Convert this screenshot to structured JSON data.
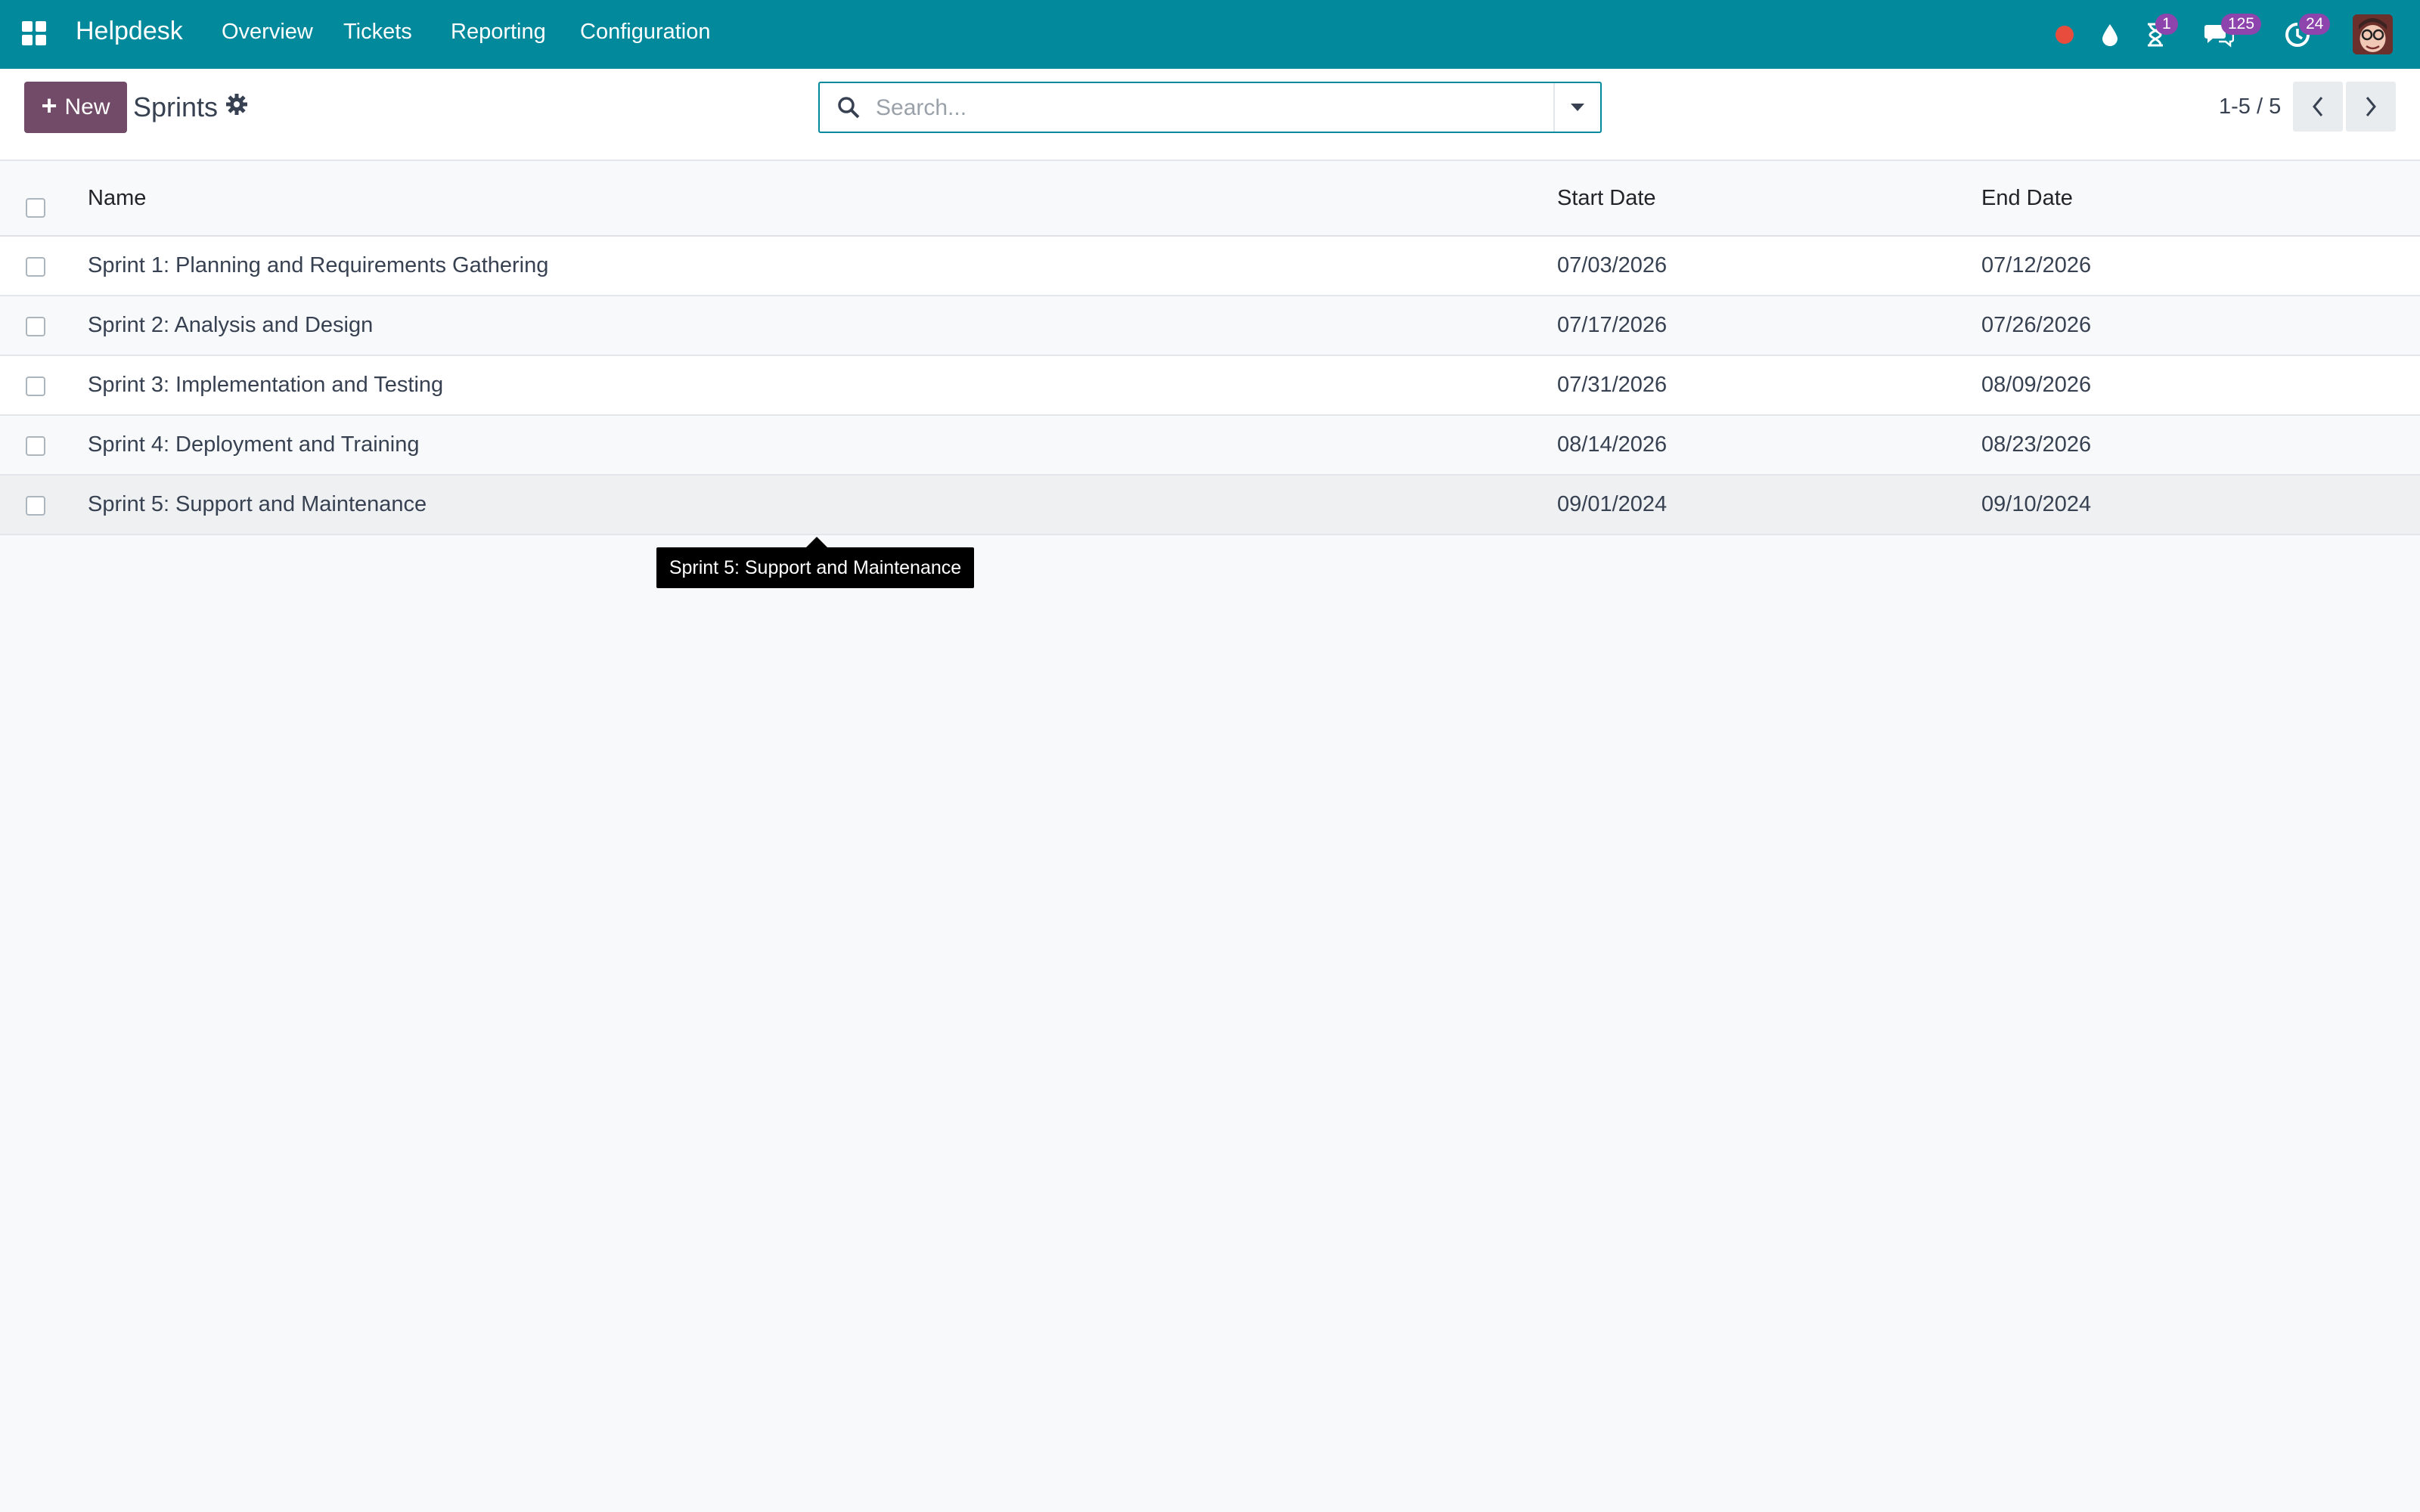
{
  "navbar": {
    "apps_icon": "apps-grid-icon",
    "brand": "Helpdesk",
    "menu": [
      "Overview",
      "Tickets",
      "Reporting",
      "Configuration"
    ],
    "systray": {
      "record_icon": "record-dot-icon",
      "drop_icon": "drop-icon",
      "activity_badge": "1",
      "messages_badge": "125",
      "clock_badge": "24"
    },
    "colors": {
      "bar": "#02899c",
      "badge": "#8e44ad",
      "record": "#e74c3c"
    }
  },
  "control": {
    "new_label": "New",
    "breadcrumb": "Sprints",
    "search_placeholder": "Search...",
    "pager": "1-5 / 5",
    "primary_color": "#714b67"
  },
  "table": {
    "columns": [
      "Name",
      "Start Date",
      "End Date"
    ],
    "rows": [
      {
        "name": "Sprint 1: Planning and Requirements Gathering",
        "start": "07/03/2026",
        "end": "07/12/2026"
      },
      {
        "name": "Sprint 2: Analysis and Design",
        "start": "07/17/2026",
        "end": "07/26/2026"
      },
      {
        "name": "Sprint 3: Implementation and Testing",
        "start": "07/31/2026",
        "end": "08/09/2026"
      },
      {
        "name": "Sprint 4: Deployment and Training",
        "start": "08/14/2026",
        "end": "08/23/2026"
      },
      {
        "name": "Sprint 5: Support and Maintenance",
        "start": "09/01/2024",
        "end": "09/10/2024"
      }
    ]
  },
  "tooltip": "Sprint 5: Support and Maintenance"
}
